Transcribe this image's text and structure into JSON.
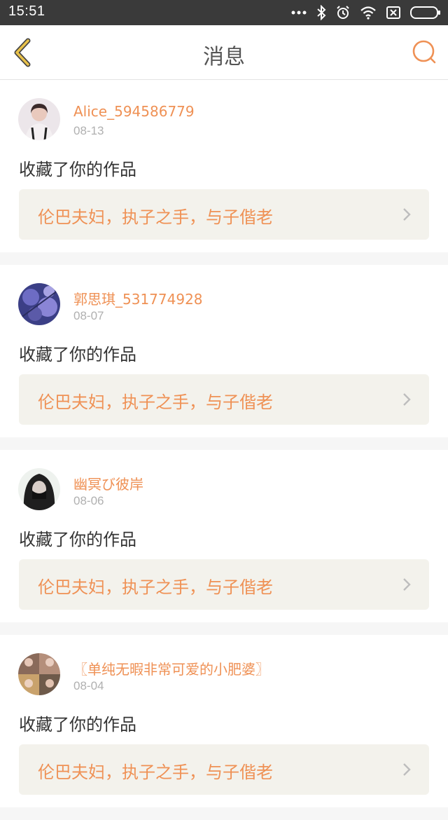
{
  "status_bar": {
    "time": "15:51"
  },
  "header": {
    "title": "消息"
  },
  "messages": [
    {
      "username": "Alice_594586779",
      "date": "08-13",
      "action": "收藏了你的作品",
      "work_title": "伦巴夫妇，执子之手，与子偕老"
    },
    {
      "username": "郭思琪_531774928",
      "date": "08-07",
      "action": "收藏了你的作品",
      "work_title": "伦巴夫妇，执子之手，与子偕老"
    },
    {
      "username": "幽冥び彼岸",
      "date": "08-06",
      "action": "收藏了你的作品",
      "work_title": "伦巴夫妇，执子之手，与子偕老"
    },
    {
      "username": "〖单纯无暇非常可爱的小肥婆〗",
      "date": "08-04",
      "action": "收藏了你的作品",
      "work_title": "伦巴夫妇，执子之手，与子偕老"
    }
  ],
  "colors": {
    "accent": "#ef9155",
    "back_arrow": "#e8c14a",
    "card_bg": "#f3f2ec",
    "status_bar": "#3a3a3a"
  },
  "icons": [
    "bluetooth-icon",
    "alarm-icon",
    "wifi-icon",
    "sim-icon",
    "battery-icon",
    "back-arrow-icon",
    "search-icon",
    "chevron-right-icon"
  ]
}
